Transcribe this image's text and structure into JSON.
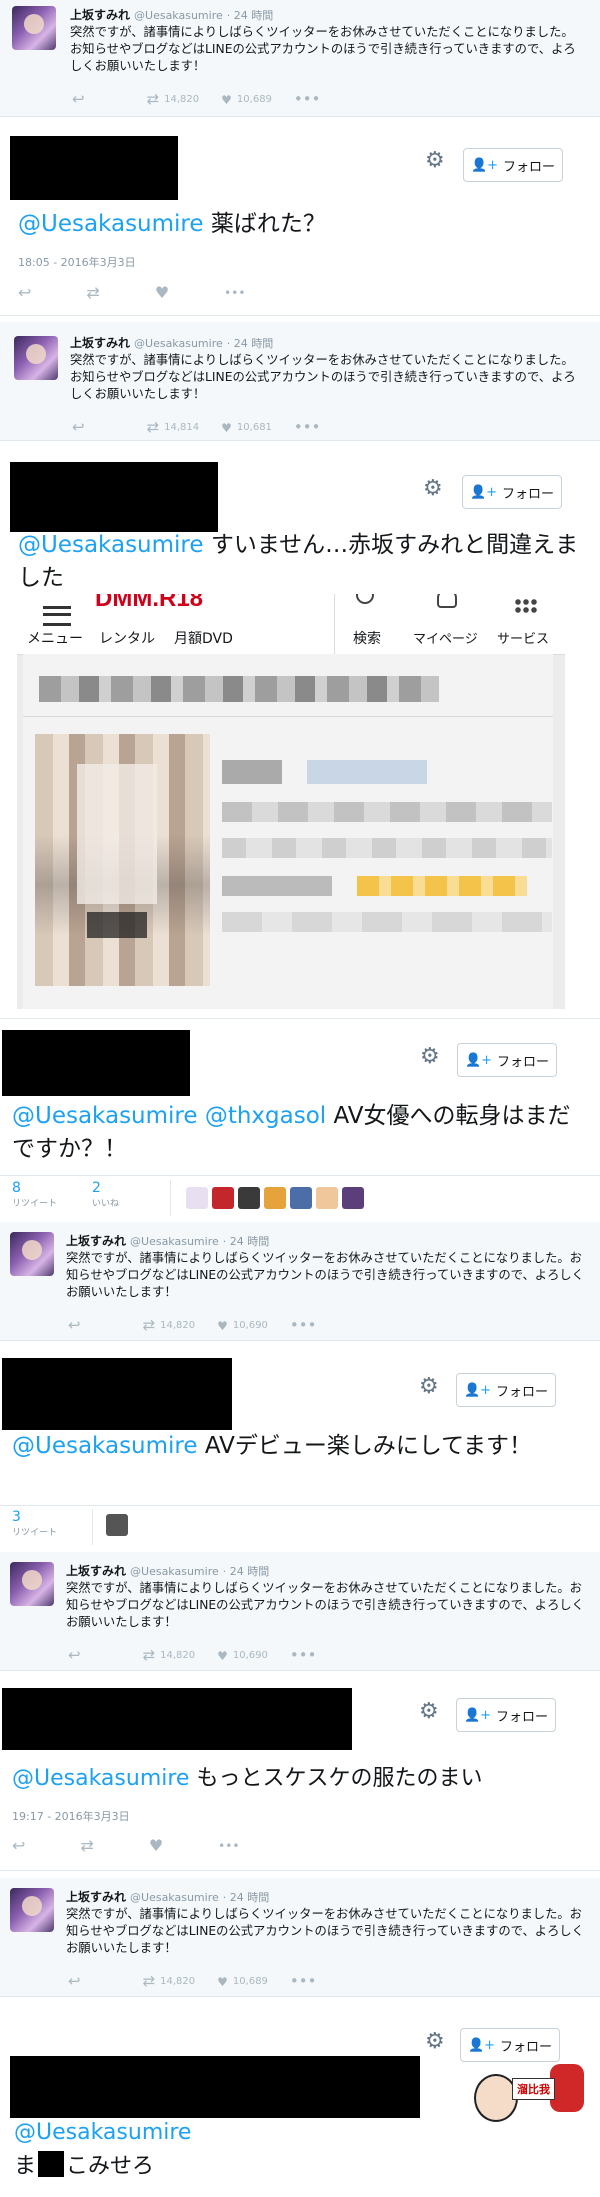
{
  "quote": {
    "name": "上坂すみれ",
    "handle": "@Uesakasumire",
    "time": "· 24 時間",
    "text": "突然ですが、諸事情によりしばらくツイッターをお休みさせていただくことになりました。お知らせやブログなどはLINEの公式アカウントのほうで引き続き行っていきますので、よろしくお願いいたします！"
  },
  "quote_counts": [
    {
      "rt": "14,820",
      "like": "10,689"
    },
    {
      "rt": "14,814",
      "like": "10,681"
    },
    {
      "rt": "14,820",
      "like": "10,690"
    },
    {
      "rt": "14,820",
      "like": "10,690"
    },
    {
      "rt": "14,820",
      "like": "10,689"
    }
  ],
  "follow_label": "フォロー",
  "replies": [
    {
      "mention": "@Uesakasumire",
      "text": " 薬ばれた？",
      "timestamp": "18:05 - 2016年3月3日"
    },
    {
      "mention": "@Uesakasumire",
      "text": " すいません…赤坂すみれと間違えました"
    },
    {
      "mention": "@Uesakasumire @thxgasol",
      "text": " AV女優への転身はまだですか？！",
      "stats": [
        {
          "num": "8",
          "label": "リツイート"
        },
        {
          "num": "2",
          "label": "いいね"
        }
      ]
    },
    {
      "mention": "@Uesakasumire",
      "text": " AVデビュー楽しみにしてます！",
      "stats": [
        {
          "num": "3",
          "label": "リツイート"
        }
      ]
    },
    {
      "mention": "@Uesakasumire",
      "text": " もっとスケスケの服たのまい",
      "timestamp": "19:17 - 2016年3月3日"
    },
    {
      "mention": "@Uesakasumire",
      "text_before": "ま",
      "text_after": "こみせろ"
    }
  ],
  "embed": {
    "logo": "DMM.R18",
    "menu": [
      "メニュー",
      "レンタル",
      "月額DVD"
    ],
    "right": [
      "検索",
      "マイページ",
      "サービス"
    ]
  },
  "sticker": "溜比我"
}
